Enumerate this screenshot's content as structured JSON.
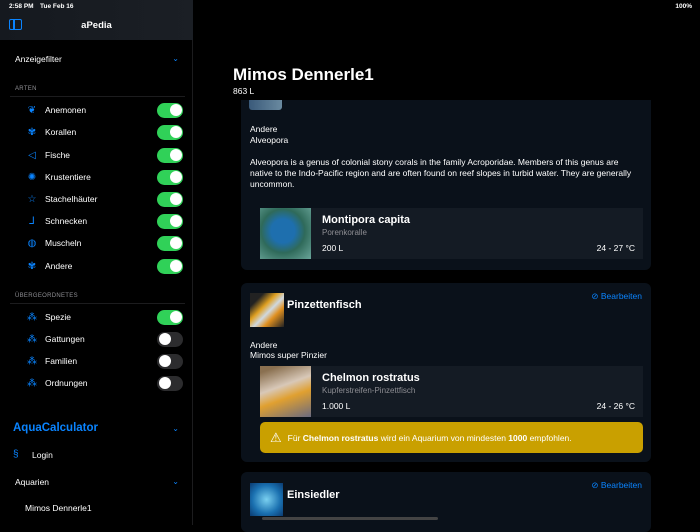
{
  "status": {
    "time": "2:58 PM",
    "date": "Tue Feb 16",
    "battery": "100%"
  },
  "sidebar": {
    "title": "aPedia",
    "filter_label": "Anzeigefilter",
    "arten_header": "ARTEN",
    "arten": [
      {
        "label": "Anemonen",
        "icon": "leaf-icon",
        "on": true
      },
      {
        "label": "Korallen",
        "icon": "coral-icon",
        "on": true
      },
      {
        "label": "Fische",
        "icon": "fish-icon",
        "on": true
      },
      {
        "label": "Krustentiere",
        "icon": "crab-icon",
        "on": true
      },
      {
        "label": "Stachelhäuter",
        "icon": "star-icon",
        "on": true
      },
      {
        "label": "Schnecken",
        "icon": "snail-icon",
        "on": true
      },
      {
        "label": "Muscheln",
        "icon": "shell-icon",
        "on": true
      },
      {
        "label": "Andere",
        "icon": "coral-icon",
        "on": true
      }
    ],
    "parent_header": "ÜBERGEORDNETES",
    "parents": [
      {
        "label": "Spezie",
        "on": true
      },
      {
        "label": "Gattungen",
        "on": false
      },
      {
        "label": "Familien",
        "on": false
      },
      {
        "label": "Ordnungen",
        "on": false
      }
    ],
    "aqua_title": "AquaCalculator",
    "login": "Login",
    "aquarien": "Aquarien",
    "aquarium": "Mimos Dennerle1"
  },
  "main": {
    "title": "Mimos Dennerle1",
    "volume": "863 L",
    "card1": {
      "category": "Andere",
      "name": "Alveopora",
      "description": "Alveopora is a genus of colonial stony corals in the family Acroporidae. Members of this genus are native to the Indo-Pacific region and are often found on reef slopes in turbid water. They are generally uncommon.",
      "species": {
        "title": "Montipora capita",
        "subtitle": "Porenkoralle",
        "volume": "200 L",
        "temp": "24 - 27 °C"
      }
    },
    "card2": {
      "title": "Pinzettenfisch",
      "edit": "Bearbeiten",
      "category": "Andere",
      "name": "Mimos super Pinzier",
      "species": {
        "title": "Chelmon rostratus",
        "subtitle": "Kupferstreifen-Pinzettfisch",
        "volume": "1.000 L",
        "temp": "24 - 26 °C"
      },
      "warning": {
        "pre": "Für ",
        "species": "Chelmon rostratus",
        "mid": " wird ein Aquarium von mindesten ",
        "amount": "1000",
        "post": " empfohlen."
      }
    },
    "card3": {
      "title": "Einsiedler",
      "edit": "Bearbeiten"
    }
  },
  "colors": {
    "accent": "#0a84ff",
    "toggle_on": "#30d158",
    "warning": "#c9a000"
  }
}
